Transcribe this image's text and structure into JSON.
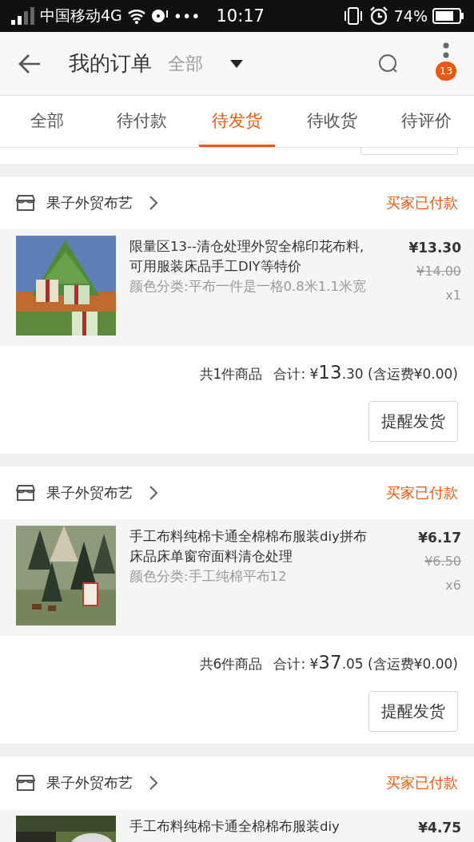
{
  "status_bar": {
    "carrier": "中国移动4G",
    "dots": "•••",
    "time": "10:17",
    "battery": "74%"
  },
  "header": {
    "title": "我的订单",
    "filter": "全部",
    "badge": "13"
  },
  "tabs": [
    {
      "label": "全部",
      "selected": false
    },
    {
      "label": "待付款",
      "selected": false
    },
    {
      "label": "待发货",
      "selected": true
    },
    {
      "label": "待收货",
      "selected": false
    },
    {
      "label": "待评价",
      "selected": false
    }
  ],
  "orders": [
    {
      "shop": "果子外贸布艺",
      "status": "买家已付款",
      "kind": "picture",
      "product": {
        "title": "限量区13--清仓处理外贸全棉印花布料,可用服装床品手工DIY等特价",
        "variant": "颜色分类:平布一件是一格0.8米1.1米宽",
        "price": "¥13.30",
        "original_price": "¥14.00",
        "quantity": "x1"
      },
      "summary": {
        "count": "共1件商品",
        "label": "合计:",
        "currency": "¥",
        "integer": "13",
        "fraction": ".30",
        "shipping": "(含运费¥0.00)"
      },
      "button": "提醒发货"
    },
    {
      "shop": "果子外贸布艺",
      "status": "买家已付款",
      "kind": "picture",
      "product": {
        "title": "手工布料纯棉卡通全棉棉布服装diy拼布床品床单窗帘面料清仓处理",
        "variant": "颜色分类:手工纯棉平布12",
        "price": "¥6.17",
        "original_price": "¥6.50",
        "quantity": "x6"
      },
      "summary": {
        "count": "共6件商品",
        "label": "合计:",
        "currency": "¥",
        "integer": "37",
        "fraction": ".05",
        "shipping": "(含运费¥0.00)"
      },
      "button": "提醒发货"
    },
    {
      "shop": "果子外贸布艺",
      "status": "买家已付款",
      "kind": "picture",
      "product": {
        "title": "手工布料纯棉卡通全棉棉布服装diy",
        "price": "¥4.75"
      }
    }
  ]
}
